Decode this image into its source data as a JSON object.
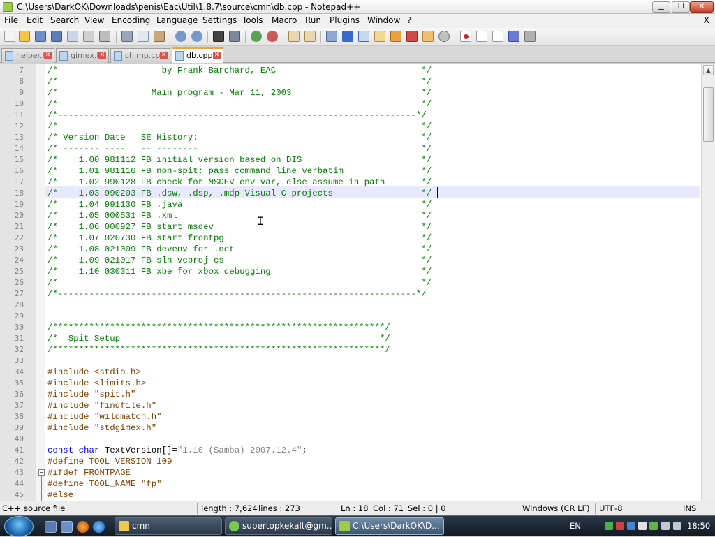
{
  "window": {
    "title": "C:\\Users\\DarkOK\\Downloads\\penis\\Eac\\Util\\1.8.7\\source\\cmn\\db.cpp - Notepad++",
    "minimize_glyph": "▁",
    "restore_glyph": "❐",
    "close_glyph": "✕"
  },
  "menu": {
    "items": [
      "File",
      "Edit",
      "Search",
      "View",
      "Encoding",
      "Language",
      "Settings",
      "Tools",
      "Macro",
      "Run",
      "Plugins",
      "Window",
      "?"
    ],
    "close_glyph": "X"
  },
  "tabs": [
    {
      "label": "helper.h",
      "active": false
    },
    {
      "label": "gimex.h",
      "active": false
    },
    {
      "label": "chimp.cpp",
      "active": false
    },
    {
      "label": "db.cpp",
      "active": true
    }
  ],
  "tab_close_glyph": "✕",
  "editor": {
    "lines": [
      {
        "num": "7",
        "text": "/*                    by Frank Barchard, EAC                            */",
        "kind": "comment"
      },
      {
        "num": "8",
        "text": "/*                                                                      */",
        "kind": "comment"
      },
      {
        "num": "9",
        "text": "/*                  Main program - Mar 11, 2003                         */",
        "kind": "comment"
      },
      {
        "num": "10",
        "text": "/*                                                                      */",
        "kind": "comment"
      },
      {
        "num": "11",
        "text": "/*---------------------------------------------------------------------*/",
        "kind": "comment"
      },
      {
        "num": "12",
        "text": "/*                                                                      */",
        "kind": "comment"
      },
      {
        "num": "13",
        "text": "/* Version Date   SE History:                                           */",
        "kind": "comment"
      },
      {
        "num": "14",
        "text": "/* ------- ----   -- --------                                           */",
        "kind": "comment"
      },
      {
        "num": "15",
        "text": "/*    1.00 981112 FB initial version based on DIS                       */",
        "kind": "comment"
      },
      {
        "num": "16",
        "text": "/*    1.01 981116 FB non-spit; pass command line verbatim               */",
        "kind": "comment"
      },
      {
        "num": "17",
        "text": "/*    1.02 990128 FB check for MSDEV env var, else assume in path       */",
        "kind": "comment"
      },
      {
        "num": "18",
        "text": "/*    1.03 990203 FB .dsw, .dsp, .mdp Visual C projects                 */",
        "kind": "comment"
      },
      {
        "num": "19",
        "text": "/*    1.04 991130 FB .java                                              */",
        "kind": "comment"
      },
      {
        "num": "20",
        "text": "/*    1.05 000531 FB .xml                                               */",
        "kind": "comment"
      },
      {
        "num": "21",
        "text": "/*    1.06 000927 FB start msdev                                        */",
        "kind": "comment"
      },
      {
        "num": "22",
        "text": "/*    1.07 020730 FB start frontpg                                      */",
        "kind": "comment"
      },
      {
        "num": "23",
        "text": "/*    1.08 021009 FB devenv for .net                                    */",
        "kind": "comment"
      },
      {
        "num": "24",
        "text": "/*    1.09 021017 FB sln vcproj cs                                      */",
        "kind": "comment"
      },
      {
        "num": "25",
        "text": "/*    1.10 030311 FB xbe for xbox debugging                             */",
        "kind": "comment"
      },
      {
        "num": "26",
        "text": "/*                                                                      */",
        "kind": "comment"
      },
      {
        "num": "27",
        "text": "/*---------------------------------------------------------------------*/",
        "kind": "comment"
      },
      {
        "num": "28",
        "text": "",
        "kind": "normal"
      },
      {
        "num": "29",
        "text": "",
        "kind": "normal"
      },
      {
        "num": "30",
        "text": "/****************************************************************/",
        "kind": "comment"
      },
      {
        "num": "31",
        "text": "/*  Spit Setup                                                  */",
        "kind": "comment"
      },
      {
        "num": "32",
        "text": "/****************************************************************/",
        "kind": "comment"
      },
      {
        "num": "33",
        "text": "",
        "kind": "normal"
      },
      {
        "num": "34",
        "text": "#include <stdio.h>",
        "kind": "pp"
      },
      {
        "num": "35",
        "text": "#include <limits.h>",
        "kind": "pp"
      },
      {
        "num": "36",
        "text": "#include \"spit.h\"",
        "kind": "pp"
      },
      {
        "num": "37",
        "text": "#include \"findfile.h\"",
        "kind": "pp"
      },
      {
        "num": "38",
        "text": "#include \"wildmatch.h\"",
        "kind": "pp"
      },
      {
        "num": "39",
        "text": "#include \"stdgimex.h\"",
        "kind": "pp"
      },
      {
        "num": "40",
        "text": "",
        "kind": "normal"
      },
      {
        "num": "41",
        "text": "",
        "kind": "const"
      },
      {
        "num": "42",
        "text": "#define TOOL_VERSION 109",
        "kind": "pp"
      },
      {
        "num": "43",
        "text": "#ifdef FRONTPAGE",
        "kind": "pp"
      },
      {
        "num": "44",
        "text": "#define TOOL_NAME \"fp\"",
        "kind": "pp"
      },
      {
        "num": "45",
        "text": "#else",
        "kind": "pp"
      }
    ],
    "const_line": {
      "kw1": "const",
      "kw2": "char",
      "ident": " TextVersion[]=",
      "string": "\"1.10 (Samba) 2007.12.4\"",
      "end": ";"
    },
    "fold_glyph": "−",
    "ibeam_glyph": "I"
  },
  "status": {
    "filetype": "C++ source file",
    "length": "length : 7,624",
    "lines": "lines : 273",
    "ln": "Ln : 18",
    "col": "Col : 71",
    "sel": "Sel : 0 | 0",
    "eol": "Windows (CR LF)",
    "encoding": "UTF-8",
    "mode": "INS"
  },
  "taskbar": {
    "buttons": [
      {
        "label": "cmn",
        "active": false
      },
      {
        "label": "supertopkekalt@gm...",
        "active": false
      },
      {
        "label": "C:\\Users\\DarkOK\\D...",
        "active": true
      }
    ],
    "language": "EN",
    "clock": "18:50"
  },
  "colors": {
    "comment": "#008000",
    "preprocessor": "#804000",
    "keyword": "#0000ff",
    "string": "#808080",
    "current_line": "#e8e8ff"
  }
}
